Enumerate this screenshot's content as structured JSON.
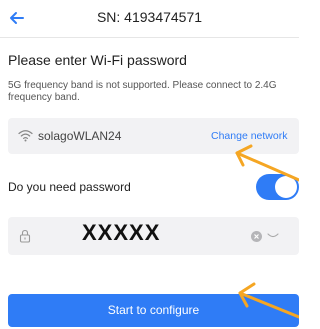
{
  "header": {
    "title": "SN: 4193474571",
    "back_icon": "arrow-left-icon"
  },
  "content": {
    "heading": "Please enter Wi-Fi password",
    "notice": "5G frequency band is not supported. Please connect to 2.4G frequency band."
  },
  "wifi": {
    "icon": "wifi-icon",
    "network_name": "solagoWLAN24",
    "change_label": "Change network"
  },
  "password_toggle": {
    "label": "Do you need password",
    "enabled": true
  },
  "password_field": {
    "icon": "lock-icon",
    "value": "XXXXX",
    "clear_icon": "clear-icon",
    "toggle_visibility_icon": "eye-closed-icon"
  },
  "actions": {
    "start_label": "Start to configure"
  },
  "colors": {
    "accent": "#2f7cf6",
    "field_background": "#f2f2f4",
    "annotation": "#f5a623"
  }
}
